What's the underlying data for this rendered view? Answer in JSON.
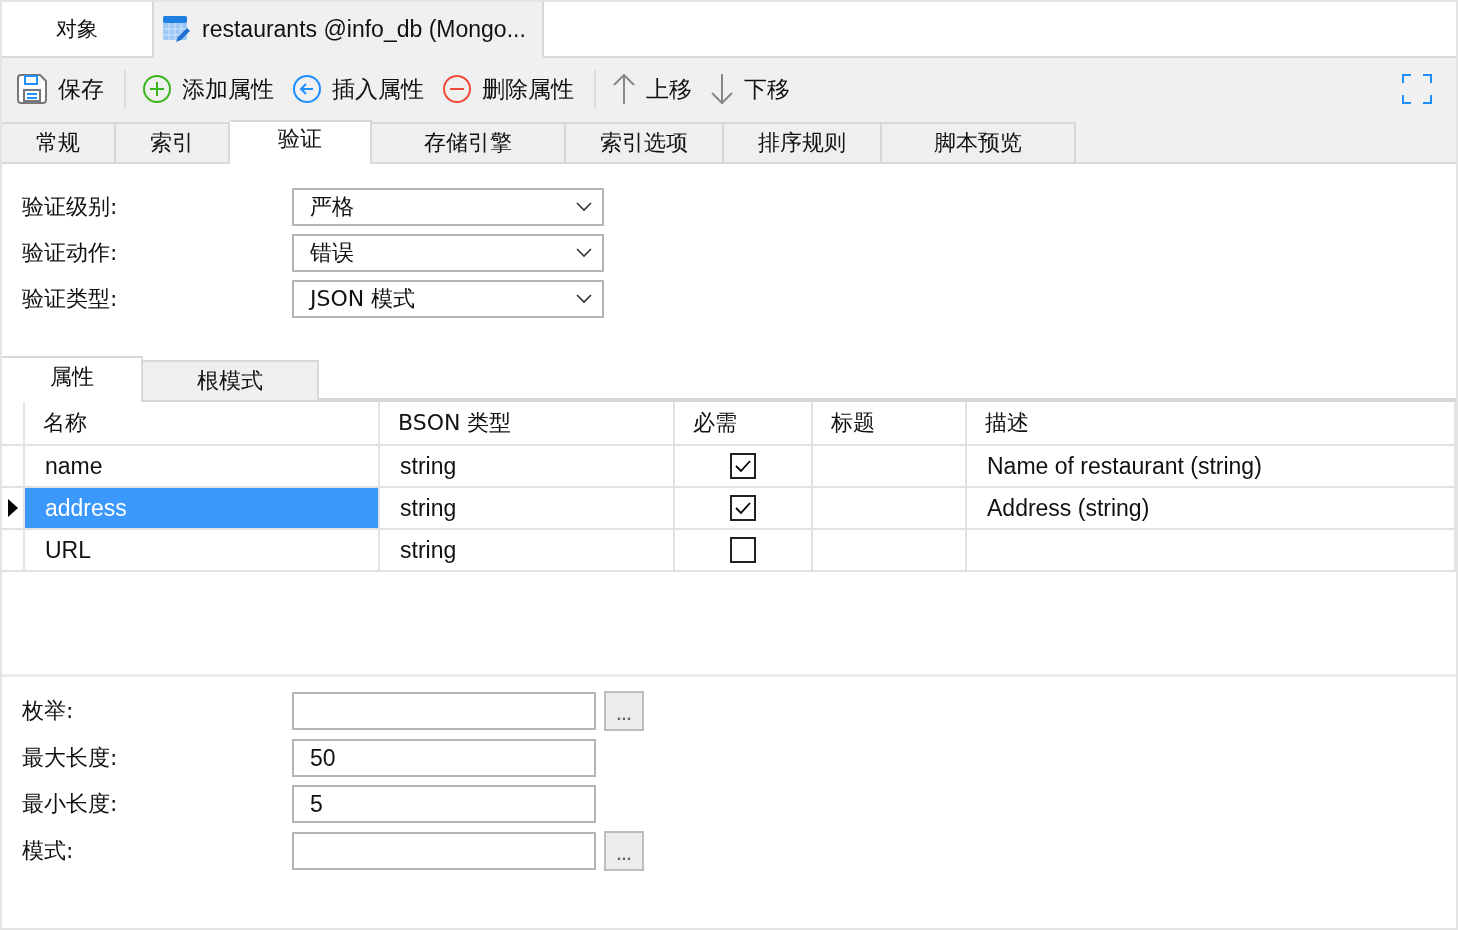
{
  "document_tabs": [
    {
      "label": "对象",
      "selected": false,
      "kind": "plain"
    },
    {
      "label": "restaurants @info_db (Mongo...",
      "selected": true,
      "kind": "collection"
    }
  ],
  "toolbar": {
    "groups": [
      [
        {
          "label": "保存",
          "kind": "save"
        }
      ],
      [
        {
          "label": "添加属性",
          "kind": "add"
        },
        {
          "label": "插入属性",
          "kind": "insert"
        },
        {
          "label": "删除属性",
          "kind": "delete"
        }
      ],
      [
        {
          "label": "上移",
          "kind": "up"
        },
        {
          "label": "下移",
          "kind": "down"
        }
      ]
    ]
  },
  "tabs": [
    {
      "label": "常规",
      "selected": false
    },
    {
      "label": "索引",
      "selected": false
    },
    {
      "label": "验证",
      "selected": true
    },
    {
      "label": "存储引擎",
      "selected": false
    },
    {
      "label": "索引选项",
      "selected": false
    },
    {
      "label": "排序规则",
      "selected": false
    },
    {
      "label": "脚本预览",
      "selected": false
    }
  ],
  "validation_fields": [
    {
      "label": "验证级别:",
      "value": "严格"
    },
    {
      "label": "验证动作:",
      "value": "错误"
    },
    {
      "label": "验证类型:",
      "value": "JSON 模式"
    }
  ],
  "subtabs": [
    {
      "label": "属性",
      "selected": true
    },
    {
      "label": "根模式",
      "selected": false
    }
  ],
  "table": {
    "columns": [
      "名称",
      "BSON 类型",
      "必需",
      "标题",
      "描述"
    ],
    "rows": [
      {
        "name": "name",
        "bson_type": "string",
        "required": true,
        "description": "Name of restaurant (string)",
        "selected": false
      },
      {
        "name": "address",
        "bson_type": "string",
        "required": true,
        "description": "Address (string)",
        "selected": true
      },
      {
        "name": "URL",
        "bson_type": "string",
        "required": false,
        "selected": false
      }
    ]
  },
  "property_fields": [
    {
      "label": "枚举:",
      "button": "..."
    },
    {
      "label": "最大长度:",
      "value": "50"
    },
    {
      "label": "最小长度:",
      "value": "5"
    },
    {
      "label": "模式:",
      "button": "..."
    }
  ]
}
